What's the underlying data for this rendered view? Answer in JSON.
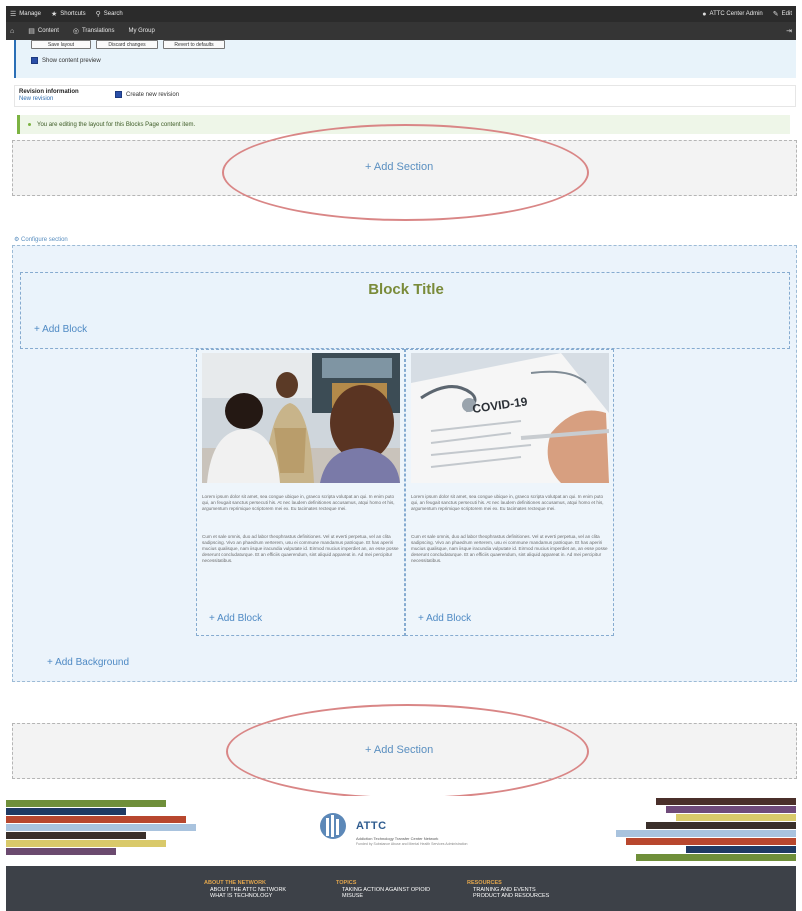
{
  "toolbar": {
    "manage": "Manage",
    "shortcuts": "Shortcuts",
    "search": "Search",
    "user": "ATTC Center Admin",
    "edit": "Edit",
    "content": "Content",
    "translations": "Translations",
    "group": "My Group"
  },
  "layout_actions": {
    "save_label": "Save layout",
    "discard_label": "Discard changes",
    "revert_label": "Revert to defaults",
    "preview_label": "Show content preview"
  },
  "revision": {
    "title": "Revision information",
    "subtitle": "New revision",
    "checkbox_label": "Create new revision"
  },
  "message": "You are editing the layout for this Blocks Page content item.",
  "add_section_label": "+ Add Section",
  "configure_section_label": "Configure section",
  "block_title": "Block Title",
  "add_block_label": "+ Add Block",
  "add_background_label": "+ Add Background",
  "cards": [
    {
      "para1": "Lorem ipsum dolor sit amet, sea congue ubique in, graeco scripta volutpat an qui. In enim puto qui, an feugait sanctus persecuti his. At nec laudem definitiones accusamus, atqui homo et his, argumentum reprimique scriptorem mei ex. Eu tacimates recteque mei.",
      "para2": "Cum et sale omnis, duo ad labor theophrastus definitiones. Vel ut everti perpetua, vel an clita sadipscing. Vivo an phaedrum verterem, usu ei commune mandamus patrioque. Et has aperiri mucius qualisque, nam iisque iracundia vulputate id. Eirmod mucius imperdiet an, an esse posse deserunt concludaturque. Et an efficiis quaerendum, sint aliquid appareat in. Ad mei percipitur necessitatibus."
    },
    {
      "para1": "Lorem ipsum dolor sit amet, sea congue ubique in, graeco scripta volutpat an qui. In enim puto qui, an feugait sanctus persecuti his. At nec laudem definitiones accusamus, atqui homo et his, argumentum reprimique scriptorem mei ex. Eu tacimates recteque mei.",
      "para2": "Cum et sale omnis, duo ad labor theophrastus definitiones. Vel ut everti perpetua, vel an clita sadipscing. Vivo an phaedrum verterem, usu ei commune mandamus patrioque. Et has aperiri mucius qualisque, nam iisque iracundia vulputate id. Eirmod mucius imperdiet an, an esse posse deserunt concludaturque. Et an efficiis quaerendum, sint aliquid appareat in. Ad mei percipitur necessitatibus."
    }
  ],
  "card2_image_text": "COVID-19",
  "footer": {
    "logo_name": "ATTC",
    "logo_sub": "Addiction Technology Transfer Center Network",
    "logo_sub2": "Funded by Substance Abuse and Mental Health Services Administration",
    "col1_head": "ABOUT THE NETWORK",
    "col1_items": [
      "ABOUT THE ATTC NETWORK",
      "WHAT IS TECHNOLOGY"
    ],
    "col2_head": "TOPICS",
    "col2_items": [
      "TAKING ACTION AGAINST OPIOID",
      "MISUSE"
    ],
    "col3_head": "RESOURCES",
    "col3_items": [
      "TRAINING AND EVENTS",
      "PRODUCT AND RESOURCES"
    ]
  },
  "colors": {
    "toolbar_bg": "#2b2b2b",
    "link_blue": "#5a8fc0",
    "block_title_olive": "#7a8b3a",
    "highlight_ellipse": "#d98686",
    "footer_bg": "#3d4148",
    "footer_heading": "#e2a64d"
  }
}
